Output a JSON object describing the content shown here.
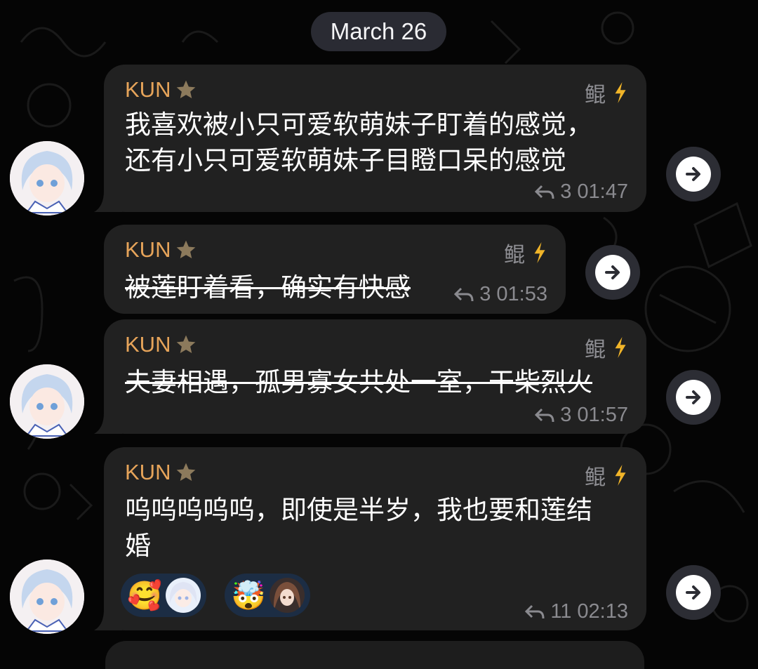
{
  "date_separator": "March 26",
  "messages": [
    {
      "sender": "KUN",
      "tag": "鲲",
      "lines": [
        "我喜欢被小只可爱软萌妹子盯着的感觉，",
        "还有小只可爱软萌妹子目瞪口呆的感觉"
      ],
      "strikethrough": false,
      "replies": "3",
      "time": "01:47"
    },
    {
      "sender": "KUN",
      "tag": "鲲",
      "lines": [
        "被莲盯着看，确实有快感"
      ],
      "strikethrough": true,
      "replies": "3",
      "time": "01:53"
    },
    {
      "sender": "KUN",
      "tag": "鲲",
      "lines": [
        "夫妻相遇，孤男寡女共处一室，干柴烈火"
      ],
      "strikethrough": true,
      "replies": "3",
      "time": "01:57"
    },
    {
      "sender": "KUN",
      "tag": "鲲",
      "lines": [
        "呜呜呜呜呜，即使是半岁，我也要和莲结",
        "婚"
      ],
      "strikethrough": false,
      "replies": "11",
      "time": "02:13",
      "reactions": [
        {
          "emoji": "🥰",
          "icon": "smiling-face-with-hearts"
        },
        {
          "emoji": "🤯",
          "icon": "exploding-head"
        }
      ]
    }
  ],
  "icons": {
    "sender_badge": "star-icon",
    "tag_badge": "lightning-icon",
    "reply": "reply-arrow-icon",
    "forward": "forward-arrow-icon"
  },
  "colors": {
    "background": "#050505",
    "bubble": "#212121",
    "sender_name": "#e6a45a",
    "meta_text": "#8a8a8f",
    "reaction_bg": "#1c2d44",
    "date_pill": "#2a2b33"
  }
}
